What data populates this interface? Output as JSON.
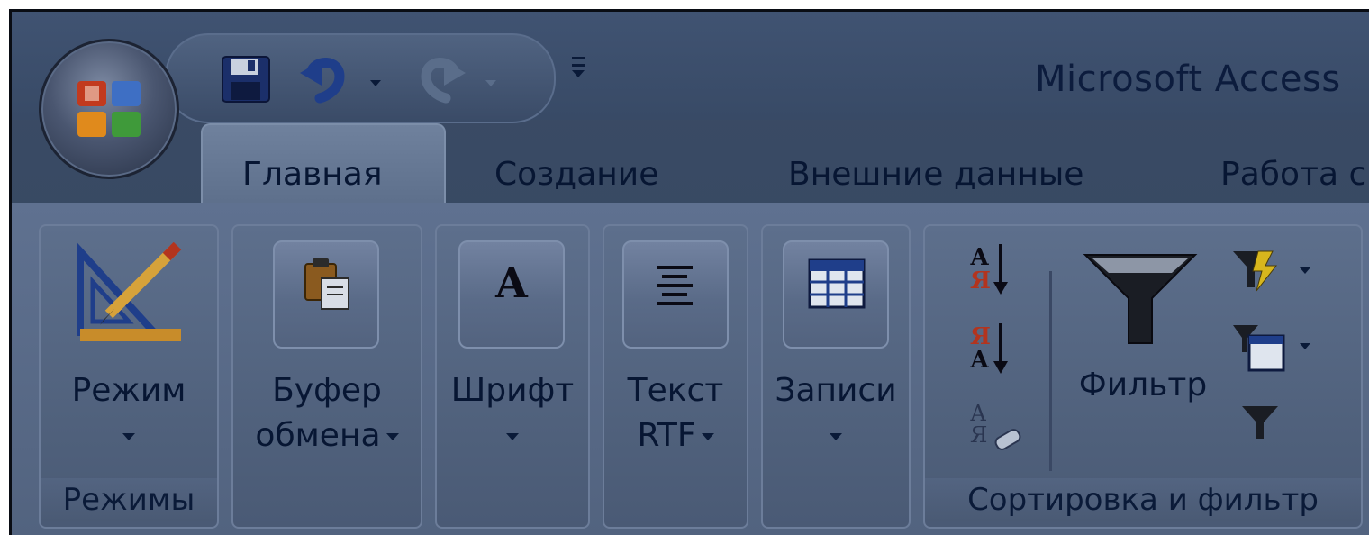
{
  "window": {
    "title": "Microsoft Access"
  },
  "quick_access": {
    "save_icon": "save-icon",
    "undo_icon": "undo-icon",
    "redo_icon": "redo-icon",
    "customize_icon": "customize-qat-icon"
  },
  "tabs": [
    {
      "label": "Главная",
      "active": true
    },
    {
      "label": "Создание",
      "active": false
    },
    {
      "label": "Внешние данные",
      "active": false
    },
    {
      "label": "Работа с",
      "active": false
    }
  ],
  "ribbon": {
    "groups": {
      "views": {
        "button_label": "Режим",
        "group_label": "Режимы"
      },
      "clipboard": {
        "button_line1": "Буфер",
        "button_line2": "обмена"
      },
      "font": {
        "button_label": "Шрифт"
      },
      "rich_text": {
        "button_line1": "Текст",
        "button_line2": "RTF"
      },
      "records": {
        "button_label": "Записи"
      },
      "sort_filter": {
        "filter_label": "Фильтр",
        "group_label": "Сортировка и фильтр",
        "sort_asc_top": "А",
        "sort_asc_bottom": "Я",
        "sort_desc_top": "Я",
        "sort_desc_bottom": "А",
        "clear_sort_top": "А",
        "clear_sort_bottom": "Я"
      }
    }
  },
  "colors": {
    "text": "#071633",
    "ribbon": "#5f7190",
    "titlebar": "#405372"
  }
}
